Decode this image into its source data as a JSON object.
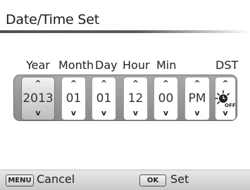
{
  "screen": {
    "title": "Date/Time Set"
  },
  "labels": {
    "year": "Year",
    "month": "Month",
    "day": "Day",
    "hour": "Hour",
    "min": "Min",
    "dst": "DST"
  },
  "fields": {
    "year": "2013",
    "month": "01",
    "day": "01",
    "hour": "12",
    "minute": "00",
    "ampm": "PM",
    "dst_icon": "dst-off-icon",
    "dst_icon_text": "OFF"
  },
  "arrows": {
    "up": "^",
    "down": "v"
  },
  "footer": {
    "menu_key": "MENU",
    "cancel_label": "Cancel",
    "ok_key": "OK",
    "set_label": "Set"
  },
  "colors": {
    "panel": "#999999",
    "selected_spinner": "#d0d0d0",
    "footer_bar": "#d6d6d6"
  }
}
